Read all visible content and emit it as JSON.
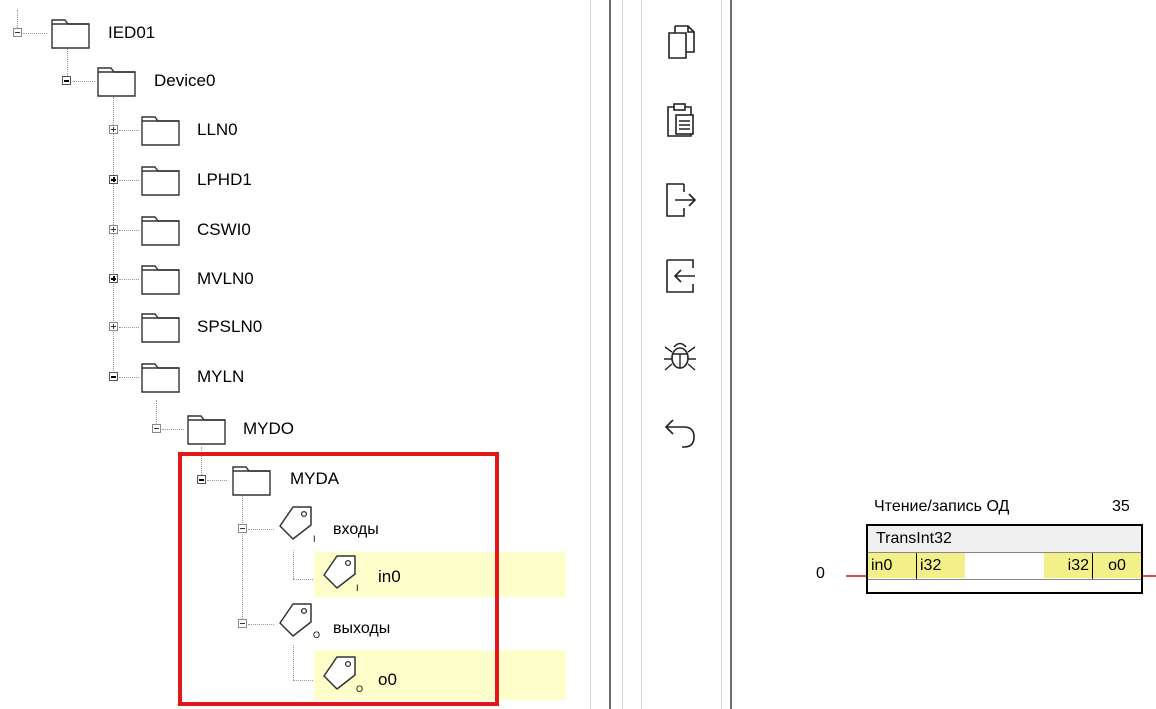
{
  "tree": {
    "nodes": [
      {
        "id": "ied01",
        "label": "IED01",
        "expander": "minus"
      },
      {
        "id": "device0",
        "label": "Device0",
        "expander": "minus-bold"
      },
      {
        "id": "lln0",
        "label": "LLN0",
        "expander": "plus"
      },
      {
        "id": "lphd1",
        "label": "LPHD1",
        "expander": "plus-bold"
      },
      {
        "id": "cswi0",
        "label": "CSWI0",
        "expander": "plus"
      },
      {
        "id": "mvln0",
        "label": "MVLN0",
        "expander": "plus-bold"
      },
      {
        "id": "spsln0",
        "label": "SPSLN0",
        "expander": "plus"
      },
      {
        "id": "myln",
        "label": "MYLN",
        "expander": "minus-bold"
      },
      {
        "id": "mydo",
        "label": "MYDO",
        "expander": "minus"
      },
      {
        "id": "myda",
        "label": "MYDA",
        "expander": "minus-bold"
      },
      {
        "id": "inputs",
        "label": "входы",
        "expander": "minus",
        "tag_mark": "I"
      },
      {
        "id": "in0",
        "label": "in0",
        "tag_mark": "I"
      },
      {
        "id": "outputs",
        "label": "выходы",
        "expander": "minus",
        "tag_mark": "O"
      },
      {
        "id": "o0",
        "label": "o0",
        "tag_mark": "O"
      }
    ]
  },
  "toolbar": {
    "buttons": [
      {
        "id": "copy",
        "icon": "copy-icon"
      },
      {
        "id": "paste",
        "icon": "paste-icon"
      },
      {
        "id": "export",
        "icon": "export-icon"
      },
      {
        "id": "import",
        "icon": "import-icon"
      },
      {
        "id": "debug",
        "icon": "bug-icon"
      },
      {
        "id": "undo",
        "icon": "undo-icon"
      }
    ]
  },
  "block": {
    "title": "Чтение/запись ОД",
    "number": "35",
    "name": "TransInt32",
    "input_value": "0",
    "in_pin": "in0",
    "in_type": "i32",
    "out_type": "i32",
    "out_pin": "o0"
  },
  "colors": {
    "highlight": "#ffffcc",
    "selection_frame": "#e21818",
    "pin_fill": "#f3f08a",
    "wire": "#e24a4a"
  }
}
